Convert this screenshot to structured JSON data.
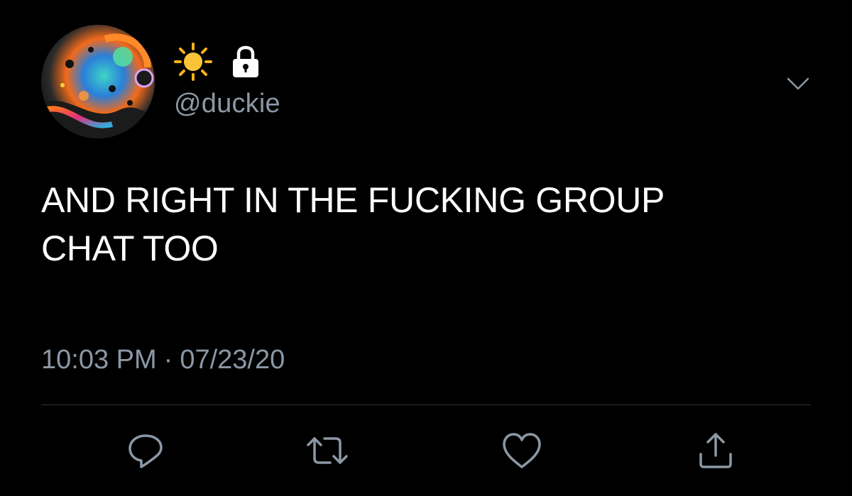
{
  "tweet": {
    "display_name_icons": [
      "sun-icon",
      "lock-icon"
    ],
    "handle": "@duckie",
    "text": "AND RIGHT IN THE FUCKING GROUP\nCHAT TOO",
    "time": "10:03 PM",
    "separator": "·",
    "date": "07/23/20"
  },
  "actions": {
    "icons": [
      "reply-icon",
      "retweet-icon",
      "like-icon",
      "share-icon"
    ]
  },
  "colors": {
    "background": "#000000",
    "text": "#ffffff",
    "secondary": "#8b98a5",
    "divider": "#2f3336",
    "sun": "#f5b316"
  }
}
